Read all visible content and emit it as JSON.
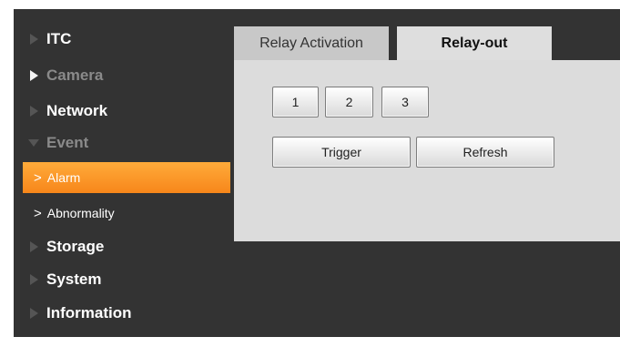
{
  "sidebar": {
    "items": [
      {
        "label": "ITC",
        "icon": "triangle-right-icon"
      },
      {
        "label": "Camera",
        "icon": "triangle-right-icon"
      },
      {
        "label": "Network",
        "icon": "triangle-right-icon"
      },
      {
        "label": "Event",
        "icon": "triangle-down-icon",
        "expanded": true
      },
      {
        "label": "Storage",
        "icon": "triangle-right-icon"
      },
      {
        "label": "System",
        "icon": "triangle-right-icon"
      },
      {
        "label": "Information",
        "icon": "triangle-right-icon"
      }
    ],
    "event_subitems": [
      {
        "label": "Alarm",
        "icon": "chevron-right-icon",
        "active": true
      },
      {
        "label": "Abnormality",
        "icon": "chevron-right-icon"
      }
    ],
    "chevron_glyph": ">"
  },
  "tabs": [
    {
      "label": "Relay Activation",
      "active": false
    },
    {
      "label": "Relay-out",
      "active": true
    }
  ],
  "relay_buttons": [
    "1",
    "2",
    "3"
  ],
  "actions": {
    "trigger_label": "Trigger",
    "refresh_label": "Refresh"
  },
  "colors": {
    "background": "#333333",
    "active_item": "#f7861a",
    "panel": "#dcdcdc"
  }
}
